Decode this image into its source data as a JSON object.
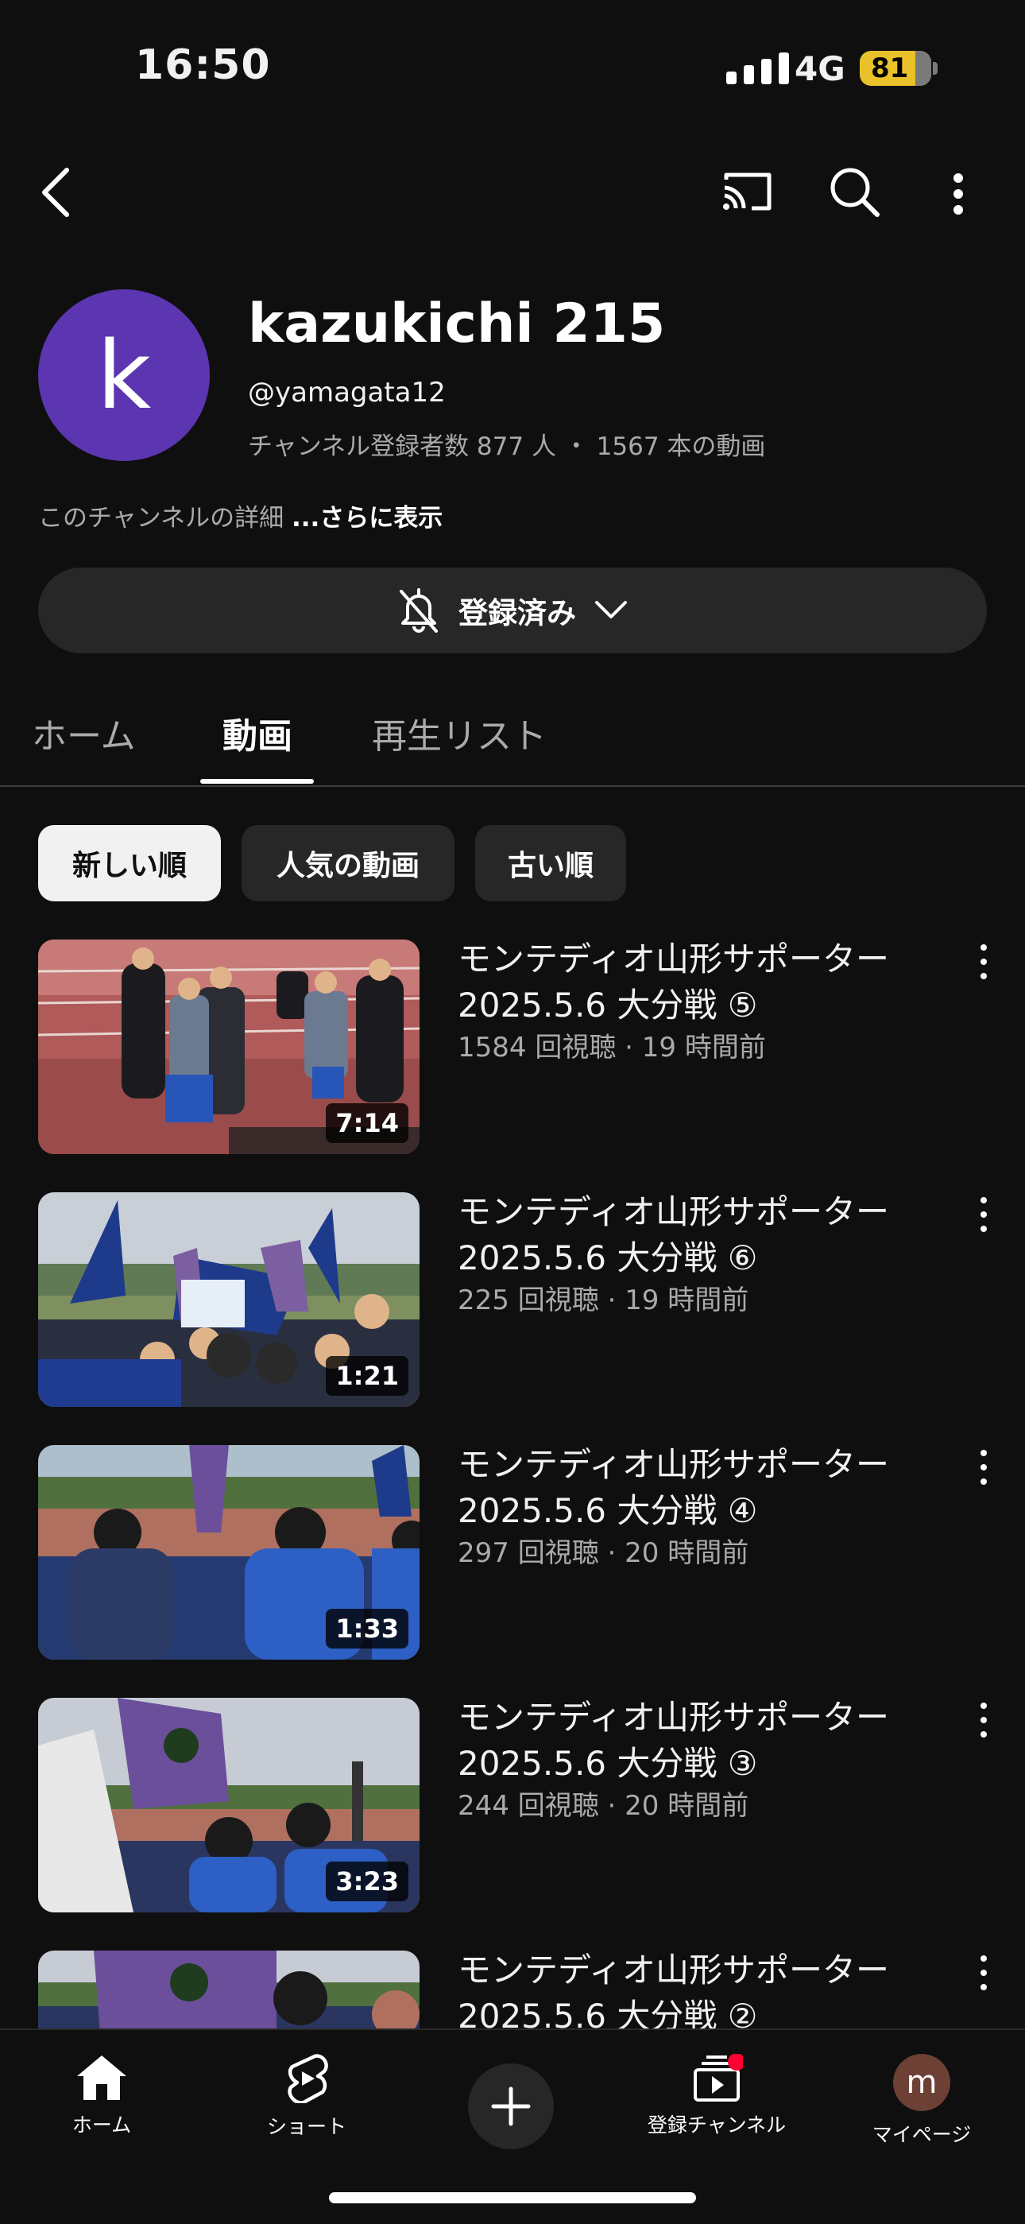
{
  "status_bar": {
    "time": "16:50",
    "network": "4G",
    "battery": "81"
  },
  "top_bar": {
    "icons": [
      "back-icon",
      "cast-icon",
      "search-icon",
      "more-vert-icon"
    ]
  },
  "channel": {
    "avatar_letter": "k",
    "avatar_color": "#5c35b0",
    "name": "kazukichi 215",
    "handle": "@yamagata12",
    "stats": "チャンネル登録者数 877 人 ・ 1567 本の動画",
    "description": "このチャンネルの詳細",
    "more_link": "...さらに表示",
    "subscribe_label": "登録済み"
  },
  "tabs": [
    {
      "label": "ホーム",
      "active": false
    },
    {
      "label": "動画",
      "active": true
    },
    {
      "label": "再生リスト",
      "active": false
    }
  ],
  "filter_chips": [
    {
      "label": "新しい順",
      "selected": true
    },
    {
      "label": "人気の動画",
      "selected": false
    },
    {
      "label": "古い順",
      "selected": false
    }
  ],
  "videos": [
    {
      "title_line1": "モンテディオ山形サポーター",
      "title_line2": "2025.5.6 大分戦 ⑤",
      "meta": "1584 回視聴 · 19 時間前",
      "duration": "7:14"
    },
    {
      "title_line1": "モンテディオ山形サポーター",
      "title_line2": "2025.5.6 大分戦 ⑥",
      "meta": "225 回視聴 · 19 時間前",
      "duration": "1:21"
    },
    {
      "title_line1": "モンテディオ山形サポーター",
      "title_line2": "2025.5.6 大分戦 ④",
      "meta": "297 回視聴 · 20 時間前",
      "duration": "1:33"
    },
    {
      "title_line1": "モンテディオ山形サポーター",
      "title_line2": "2025.5.6 大分戦 ③",
      "meta": "244 回視聴 · 20 時間前",
      "duration": "3:23"
    },
    {
      "title_line1": "モンテディオ山形サポーター",
      "title_line2": "2025.5.6 大分戦 ②"
    }
  ],
  "bottom_nav": {
    "home": "ホーム",
    "shorts": "ショート",
    "subscriptions": "登録チャンネル",
    "me": "マイページ",
    "me_avatar_letter": "m"
  },
  "colors": {
    "background": "#0f0f0f",
    "accent_red": "#ff0033",
    "battery": "#e9c12a"
  }
}
